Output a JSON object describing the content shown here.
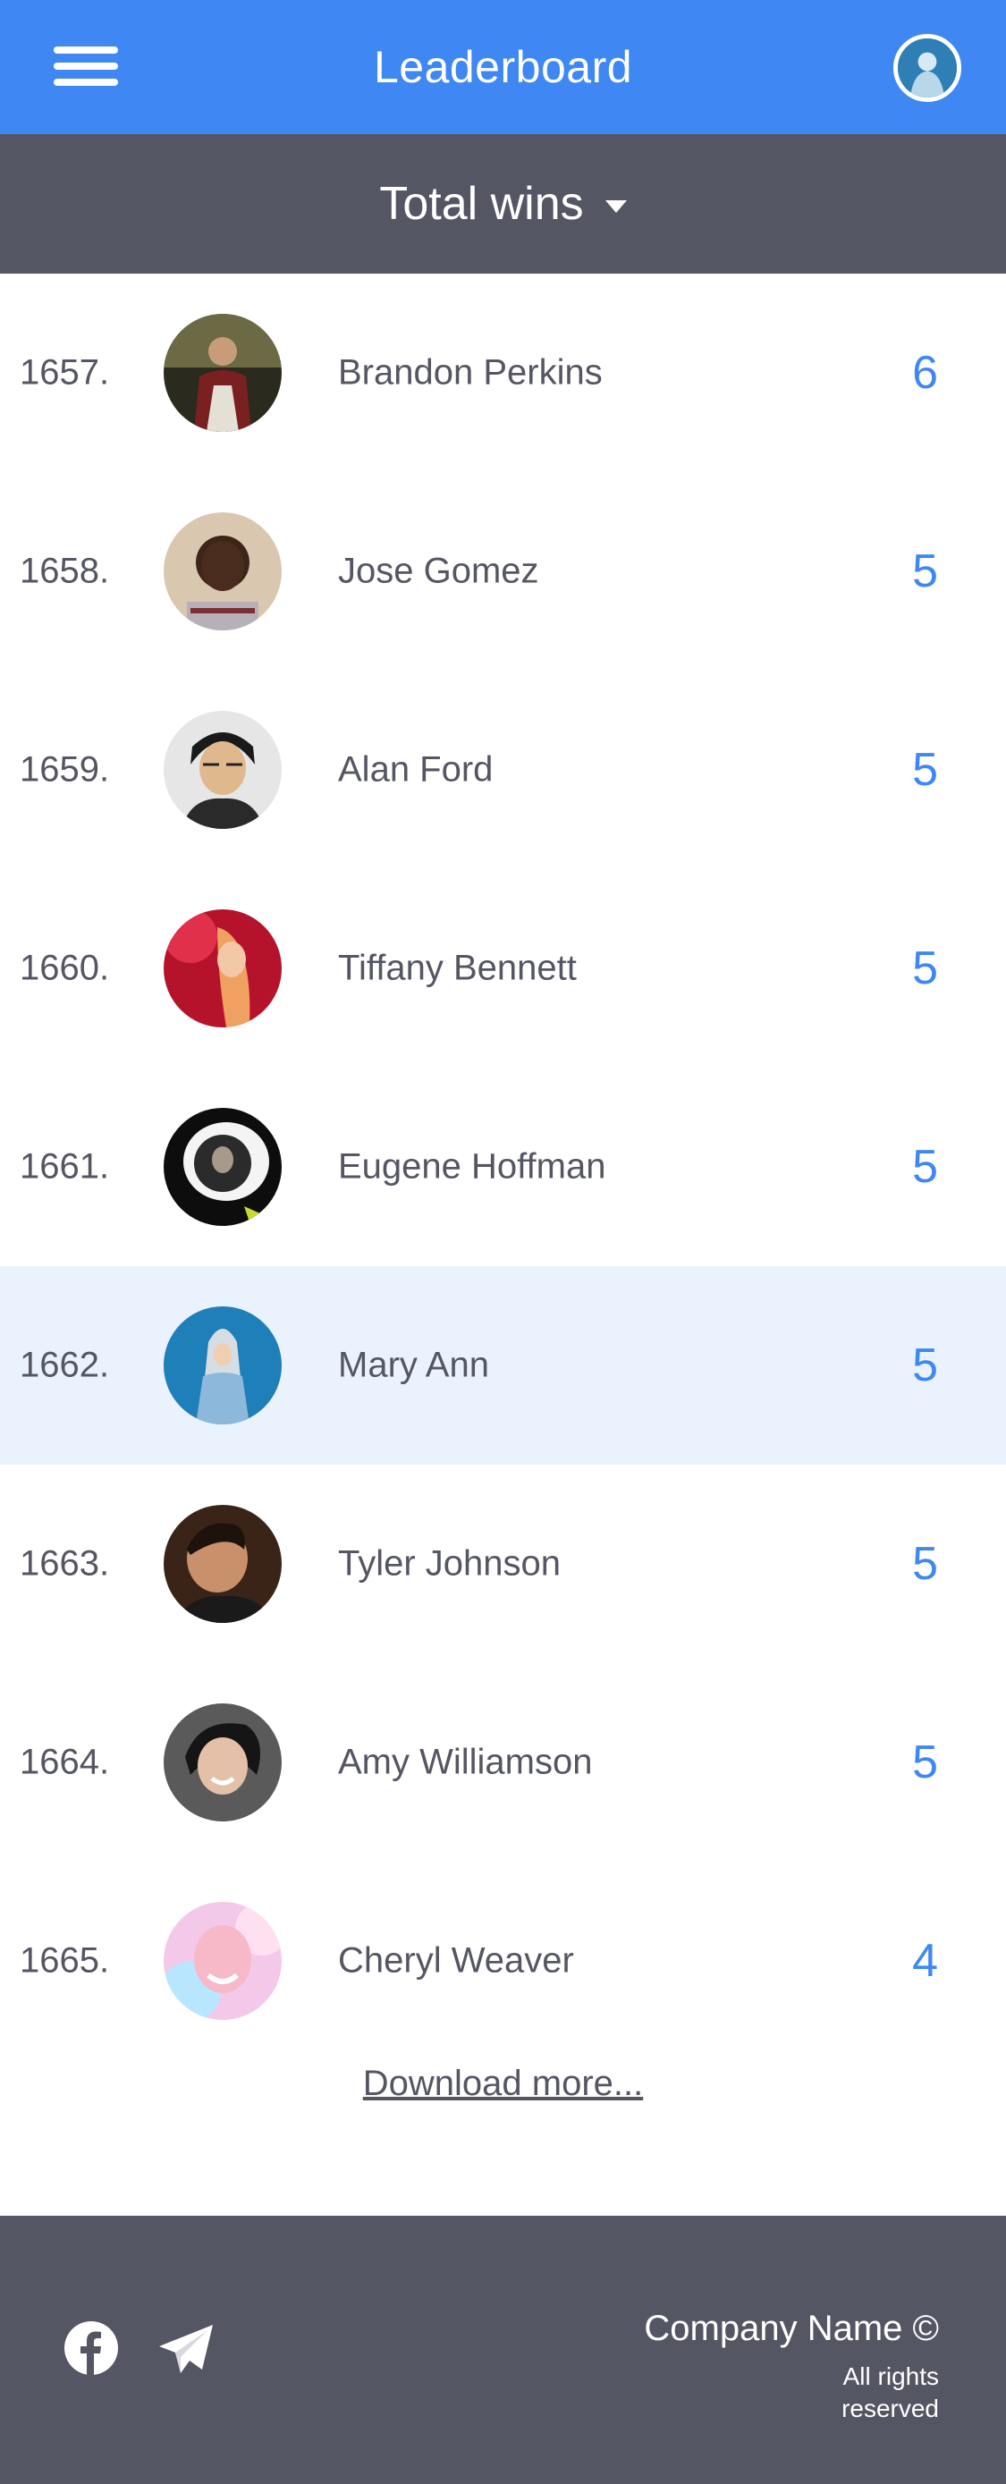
{
  "header": {
    "title": "Leaderboard",
    "menu_icon": "hamburger-menu-icon",
    "avatar": "user-avatar"
  },
  "sort": {
    "label": "Total wins",
    "icon": "caret-down-icon"
  },
  "rows": [
    {
      "rank": "1657.",
      "name": "Brandon Perkins",
      "score": "6"
    },
    {
      "rank": "1658.",
      "name": "Jose Gomez",
      "score": "5"
    },
    {
      "rank": "1659.",
      "name": "Alan Ford",
      "score": "5"
    },
    {
      "rank": "1660.",
      "name": "Tiffany Bennett",
      "score": "5"
    },
    {
      "rank": "1661.",
      "name": "Eugene Hoffman",
      "score": "5"
    },
    {
      "rank": "1662.",
      "name": "Mary Ann",
      "score": "5"
    },
    {
      "rank": "1663.",
      "name": "Tyler Johnson",
      "score": "5"
    },
    {
      "rank": "1664.",
      "name": "Amy Williamson",
      "score": "5"
    },
    {
      "rank": "1665.",
      "name": "Cheryl Weaver",
      "score": "4"
    }
  ],
  "load_more": "Download more...",
  "footer": {
    "company": "Company Name ©",
    "rights_line1": "All rights",
    "rights_line2": "reserved",
    "icons": [
      "facebook-icon",
      "telegram-icon"
    ]
  },
  "colors": {
    "primary": "#3f87f2",
    "dark": "#555663",
    "highlight": "#eaf2fe"
  }
}
